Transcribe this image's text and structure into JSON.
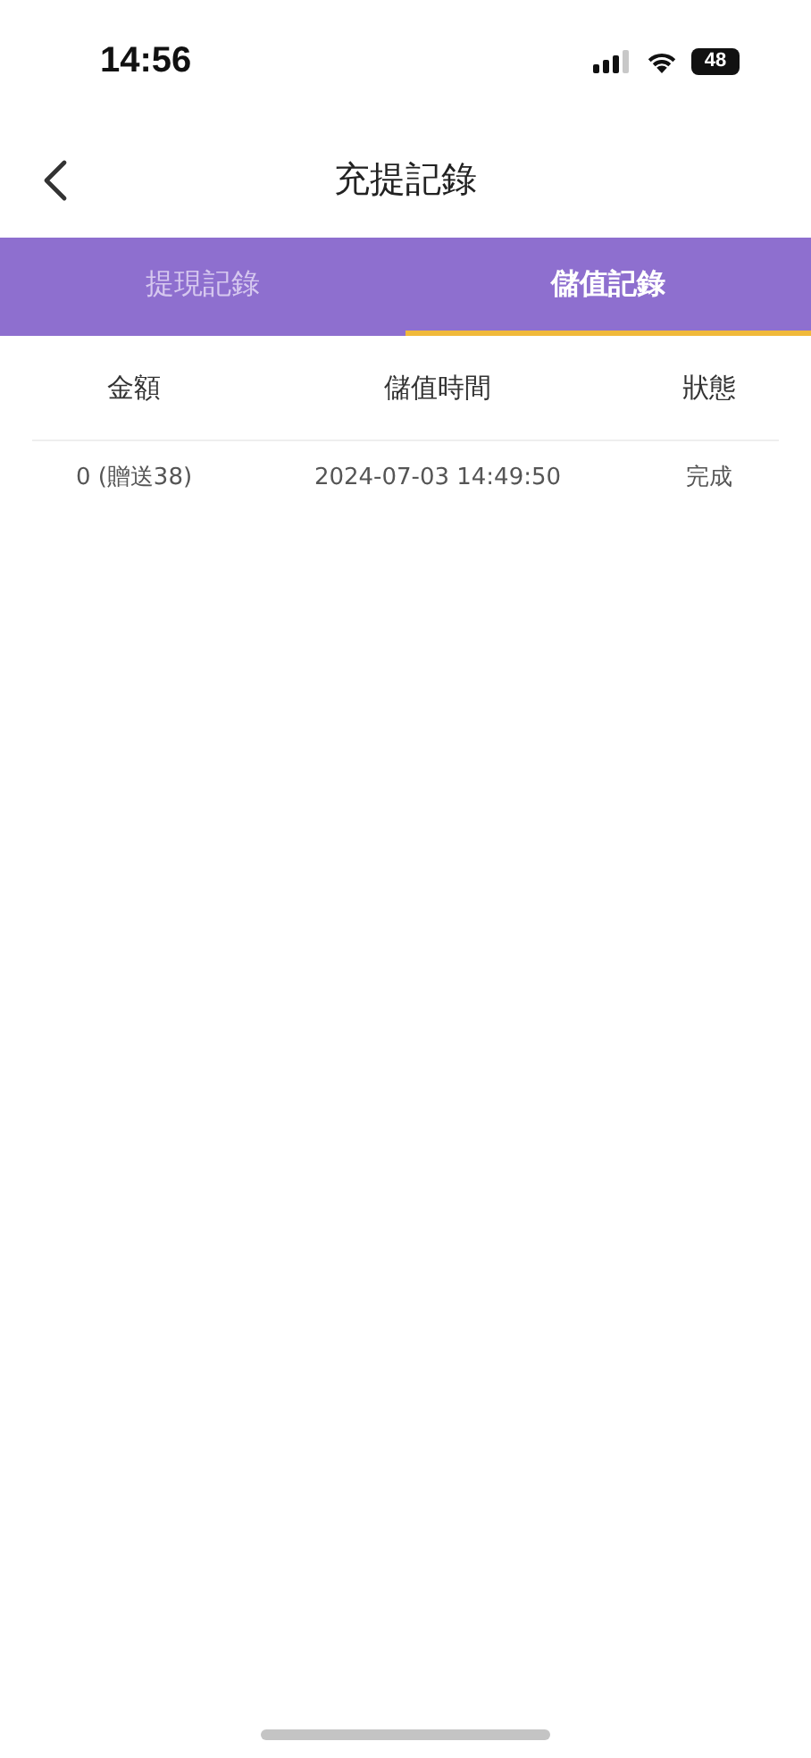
{
  "status_bar": {
    "time": "14:56",
    "battery": "48"
  },
  "nav": {
    "title": "充提記錄"
  },
  "tabs": [
    {
      "label": "提現記錄",
      "selected": false
    },
    {
      "label": "儲值記錄",
      "selected": true
    }
  ],
  "table": {
    "columns": [
      "金額",
      "儲值時間",
      "狀態"
    ],
    "rows": [
      [
        "0 (贈送38)",
        "2024-07-03 14:49:50",
        "完成"
      ]
    ]
  }
}
